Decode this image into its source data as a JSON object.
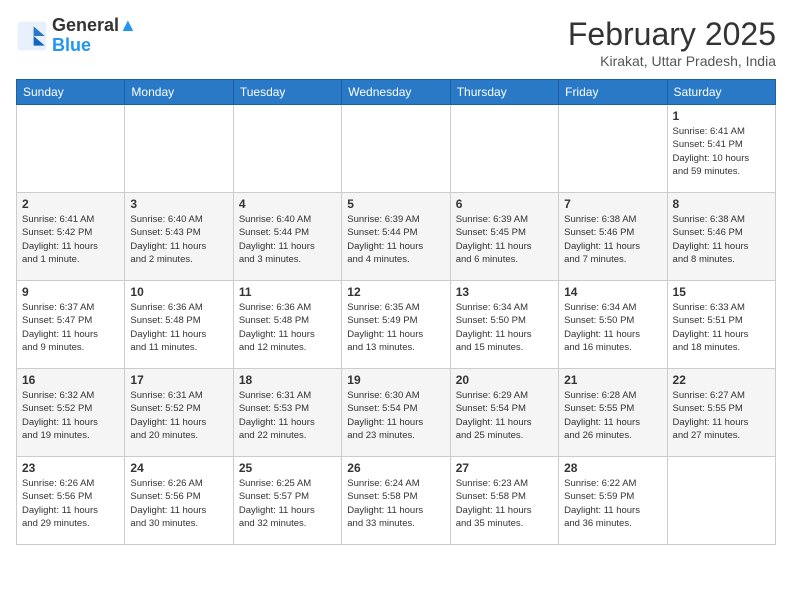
{
  "header": {
    "logo_line1": "General",
    "logo_line2": "Blue",
    "month": "February 2025",
    "location": "Kirakat, Uttar Pradesh, India"
  },
  "weekdays": [
    "Sunday",
    "Monday",
    "Tuesday",
    "Wednesday",
    "Thursday",
    "Friday",
    "Saturday"
  ],
  "weeks": [
    [
      {
        "day": "",
        "info": ""
      },
      {
        "day": "",
        "info": ""
      },
      {
        "day": "",
        "info": ""
      },
      {
        "day": "",
        "info": ""
      },
      {
        "day": "",
        "info": ""
      },
      {
        "day": "",
        "info": ""
      },
      {
        "day": "1",
        "info": "Sunrise: 6:41 AM\nSunset: 5:41 PM\nDaylight: 10 hours\nand 59 minutes."
      }
    ],
    [
      {
        "day": "2",
        "info": "Sunrise: 6:41 AM\nSunset: 5:42 PM\nDaylight: 11 hours\nand 1 minute."
      },
      {
        "day": "3",
        "info": "Sunrise: 6:40 AM\nSunset: 5:43 PM\nDaylight: 11 hours\nand 2 minutes."
      },
      {
        "day": "4",
        "info": "Sunrise: 6:40 AM\nSunset: 5:44 PM\nDaylight: 11 hours\nand 3 minutes."
      },
      {
        "day": "5",
        "info": "Sunrise: 6:39 AM\nSunset: 5:44 PM\nDaylight: 11 hours\nand 4 minutes."
      },
      {
        "day": "6",
        "info": "Sunrise: 6:39 AM\nSunset: 5:45 PM\nDaylight: 11 hours\nand 6 minutes."
      },
      {
        "day": "7",
        "info": "Sunrise: 6:38 AM\nSunset: 5:46 PM\nDaylight: 11 hours\nand 7 minutes."
      },
      {
        "day": "8",
        "info": "Sunrise: 6:38 AM\nSunset: 5:46 PM\nDaylight: 11 hours\nand 8 minutes."
      }
    ],
    [
      {
        "day": "9",
        "info": "Sunrise: 6:37 AM\nSunset: 5:47 PM\nDaylight: 11 hours\nand 9 minutes."
      },
      {
        "day": "10",
        "info": "Sunrise: 6:36 AM\nSunset: 5:48 PM\nDaylight: 11 hours\nand 11 minutes."
      },
      {
        "day": "11",
        "info": "Sunrise: 6:36 AM\nSunset: 5:48 PM\nDaylight: 11 hours\nand 12 minutes."
      },
      {
        "day": "12",
        "info": "Sunrise: 6:35 AM\nSunset: 5:49 PM\nDaylight: 11 hours\nand 13 minutes."
      },
      {
        "day": "13",
        "info": "Sunrise: 6:34 AM\nSunset: 5:50 PM\nDaylight: 11 hours\nand 15 minutes."
      },
      {
        "day": "14",
        "info": "Sunrise: 6:34 AM\nSunset: 5:50 PM\nDaylight: 11 hours\nand 16 minutes."
      },
      {
        "day": "15",
        "info": "Sunrise: 6:33 AM\nSunset: 5:51 PM\nDaylight: 11 hours\nand 18 minutes."
      }
    ],
    [
      {
        "day": "16",
        "info": "Sunrise: 6:32 AM\nSunset: 5:52 PM\nDaylight: 11 hours\nand 19 minutes."
      },
      {
        "day": "17",
        "info": "Sunrise: 6:31 AM\nSunset: 5:52 PM\nDaylight: 11 hours\nand 20 minutes."
      },
      {
        "day": "18",
        "info": "Sunrise: 6:31 AM\nSunset: 5:53 PM\nDaylight: 11 hours\nand 22 minutes."
      },
      {
        "day": "19",
        "info": "Sunrise: 6:30 AM\nSunset: 5:54 PM\nDaylight: 11 hours\nand 23 minutes."
      },
      {
        "day": "20",
        "info": "Sunrise: 6:29 AM\nSunset: 5:54 PM\nDaylight: 11 hours\nand 25 minutes."
      },
      {
        "day": "21",
        "info": "Sunrise: 6:28 AM\nSunset: 5:55 PM\nDaylight: 11 hours\nand 26 minutes."
      },
      {
        "day": "22",
        "info": "Sunrise: 6:27 AM\nSunset: 5:55 PM\nDaylight: 11 hours\nand 27 minutes."
      }
    ],
    [
      {
        "day": "23",
        "info": "Sunrise: 6:26 AM\nSunset: 5:56 PM\nDaylight: 11 hours\nand 29 minutes."
      },
      {
        "day": "24",
        "info": "Sunrise: 6:26 AM\nSunset: 5:56 PM\nDaylight: 11 hours\nand 30 minutes."
      },
      {
        "day": "25",
        "info": "Sunrise: 6:25 AM\nSunset: 5:57 PM\nDaylight: 11 hours\nand 32 minutes."
      },
      {
        "day": "26",
        "info": "Sunrise: 6:24 AM\nSunset: 5:58 PM\nDaylight: 11 hours\nand 33 minutes."
      },
      {
        "day": "27",
        "info": "Sunrise: 6:23 AM\nSunset: 5:58 PM\nDaylight: 11 hours\nand 35 minutes."
      },
      {
        "day": "28",
        "info": "Sunrise: 6:22 AM\nSunset: 5:59 PM\nDaylight: 11 hours\nand 36 minutes."
      },
      {
        "day": "",
        "info": ""
      }
    ]
  ]
}
